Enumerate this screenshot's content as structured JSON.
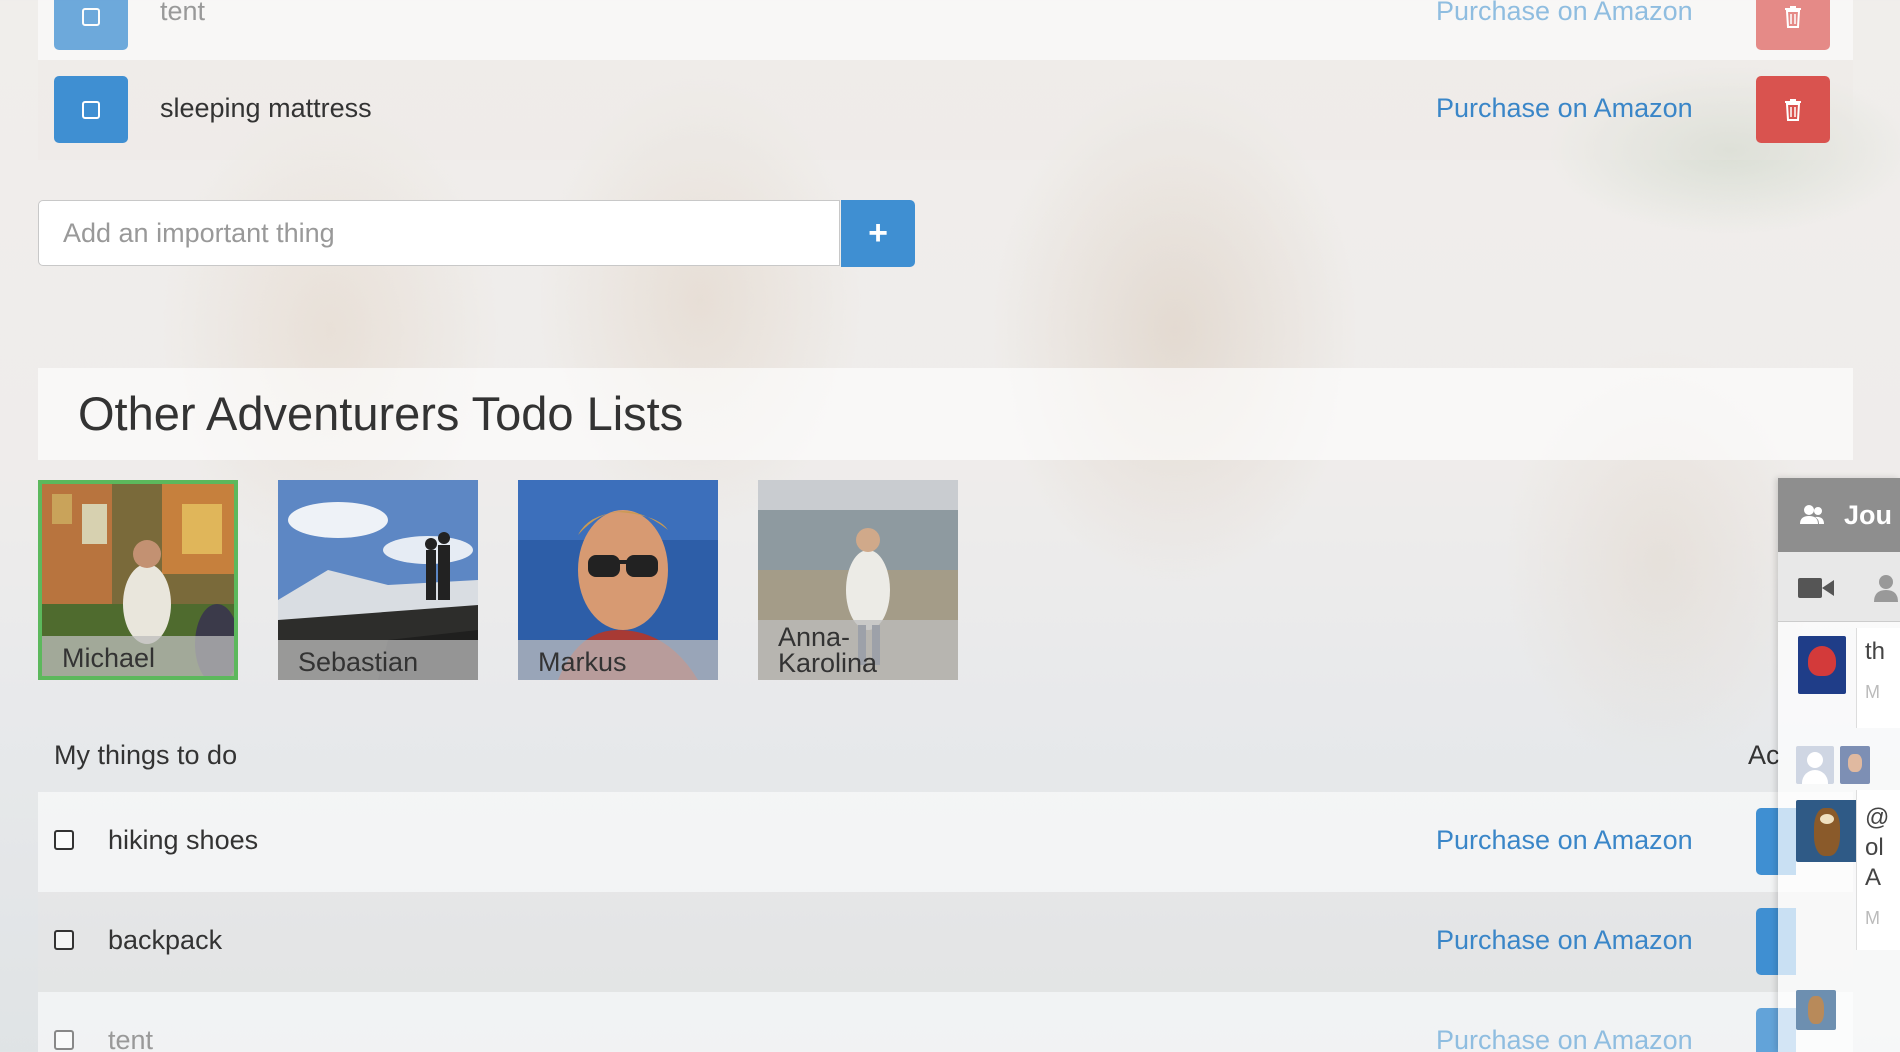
{
  "todo_top": {
    "items": [
      {
        "label": "tent",
        "link": "Purchase on Amazon"
      },
      {
        "label": "sleeping mattress",
        "link": "Purchase on Amazon"
      }
    ]
  },
  "add_form": {
    "placeholder": "Add an important thing",
    "button_label": "+"
  },
  "adventurers": {
    "title": "Other Adventurers Todo Lists",
    "people": [
      {
        "name": "Michael",
        "selected": true
      },
      {
        "name": "Sebastian",
        "selected": false
      },
      {
        "name": "Markus",
        "selected": false
      },
      {
        "name": "Anna-Karolina",
        "selected": false
      }
    ]
  },
  "friend_list": {
    "heading": "My things to do",
    "action_heading": "Ac",
    "items": [
      {
        "label": "hiking shoes",
        "link": "Purchase on Amazon"
      },
      {
        "label": "backpack",
        "link": "Purchase on Amazon"
      },
      {
        "label": "tent",
        "link": "Purchase on Amazon"
      }
    ]
  },
  "chat_panel": {
    "title": "Jou",
    "snippet_1": "th",
    "snippet_1_meta": "M",
    "snippet_2_line1": "@",
    "snippet_2_line2": "ol",
    "snippet_2_line3": "A",
    "snippet_2_meta": "M"
  },
  "colors": {
    "primary": "#3f8fd2",
    "danger": "#d9534f",
    "link": "#3a86c8",
    "selected_border": "#5cb85c"
  }
}
